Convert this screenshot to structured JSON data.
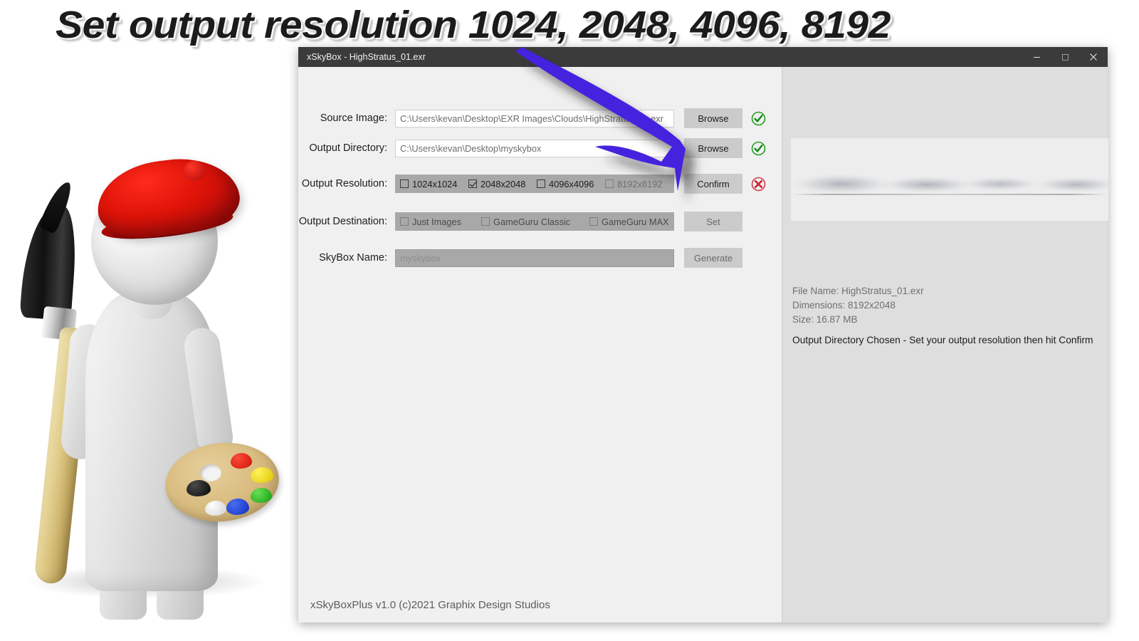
{
  "banner": {
    "text": "Set output resolution 1024, 2048, 4096, 8192"
  },
  "window": {
    "title": "xSkyBox - HighStratus_01.exr",
    "controls": {
      "minimize": "minimize-icon",
      "maximize": "maximize-icon",
      "close": "close-icon"
    }
  },
  "form": {
    "source_image": {
      "label": "Source Image:",
      "value": "C:\\Users\\kevan\\Desktop\\EXR Images\\Clouds\\HighStratus_01.exr",
      "button": "Browse",
      "status": "ok"
    },
    "output_directory": {
      "label": "Output Directory:",
      "value": "C:\\Users\\kevan\\Desktop\\myskybox",
      "button": "Browse",
      "status": "ok"
    },
    "output_resolution": {
      "label": "Output Resolution:",
      "button": "Confirm",
      "status": "error",
      "options": [
        {
          "label": "1024x1024",
          "checked": false,
          "disabled": false
        },
        {
          "label": "2048x2048",
          "checked": true,
          "disabled": false
        },
        {
          "label": "4096x4096",
          "checked": false,
          "disabled": false
        },
        {
          "label": "8192x8192",
          "checked": false,
          "disabled": true
        }
      ]
    },
    "output_destination": {
      "label": "Output Destination:",
      "button": "Set",
      "options": [
        {
          "label": "Just Images",
          "checked": false,
          "disabled": true
        },
        {
          "label": "GameGuru Classic",
          "checked": false,
          "disabled": true
        },
        {
          "label": "GameGuru MAX",
          "checked": false,
          "disabled": true
        }
      ]
    },
    "skybox_name": {
      "label": "SkyBox Name:",
      "placeholder": "myskybox",
      "value": "",
      "button": "Generate"
    }
  },
  "footer": {
    "text": "xSkyBoxPlus v1.0 (c)2021 Graphix Design Studios"
  },
  "preview": {
    "file_name": "File Name: HighStratus_01.exr",
    "dimensions": "Dimensions: 8192x2048",
    "size": "Size: 16.87 MB",
    "status_message": "Output Directory Chosen - Set your output resolution then hit Confirm"
  },
  "colors": {
    "titlebar": "#3b3b3b",
    "window_bg": "#f0f0f0",
    "preview_bg": "#dedede",
    "field_disabled": "#a8a8a8",
    "button": "#cbcbcb",
    "ok_green": "#1e9e1e",
    "error_red": "#cc2233",
    "arrow_blue": "#4422dd"
  }
}
